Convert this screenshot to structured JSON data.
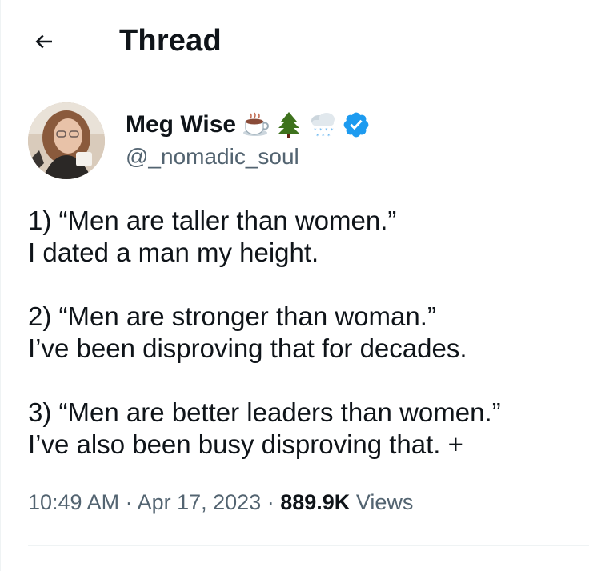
{
  "header": {
    "back_icon": "arrow-left-icon",
    "title": "Thread"
  },
  "author": {
    "display_name": "Meg Wise",
    "emojis": [
      "hot-beverage-icon",
      "evergreen-tree-icon",
      "snow-cloud-icon"
    ],
    "verified_icon": "verified-badge-icon",
    "handle": "@_nomadic_soul",
    "avatar_icon": "avatar"
  },
  "tweet": {
    "lines": [
      "1) “Men are taller than women.”",
      "I dated a man my height.",
      "",
      "2) “Men are stronger than woman.”",
      "I’ve been disproving that for decades.",
      "",
      "3) “Men are better leaders than women.”",
      "I’ve also been busy disproving that. +"
    ]
  },
  "meta": {
    "time": "10:49 AM",
    "separator": " · ",
    "date": "Apr 17, 2023",
    "views_count": "889.9K",
    "views_label": "Views"
  },
  "colors": {
    "text": "#0f1419",
    "secondary": "#536471",
    "verified": "#1d9bf0",
    "divider": "#eff3f4"
  }
}
